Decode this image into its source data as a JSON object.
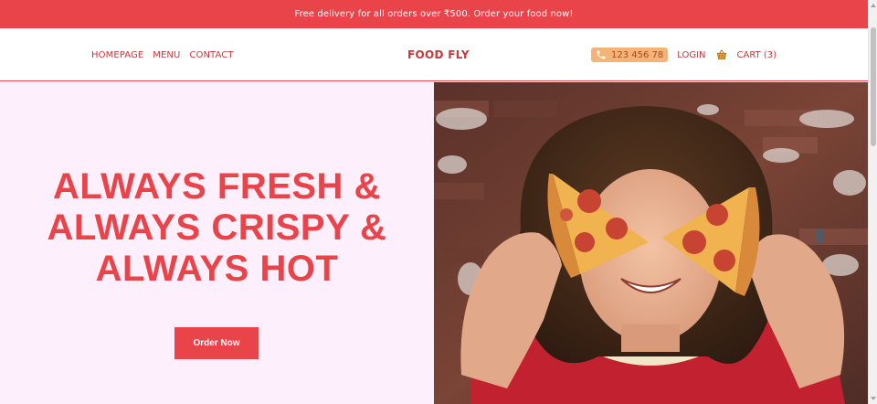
{
  "promo": {
    "text": "Free delivery for all orders over ₹500. Order your food now!"
  },
  "nav": {
    "left_links": [
      "HOMEPAGE",
      "MENU",
      "CONTACT"
    ],
    "brand": "FOOD FLY",
    "phone": "123 456 78",
    "login": "LOGIN",
    "cart": "CART (3)"
  },
  "hero": {
    "headline_lines": [
      "ALWAYS FRESH &",
      "ALWAYS CRISPY &",
      "ALWAYS HOT"
    ],
    "cta": "Order Now",
    "image_icon": "person-with-pizza-photo"
  },
  "colors": {
    "brand_red": "#e8444a",
    "hero_bg": "#fdeffb",
    "phone_pill": "#f4b377"
  }
}
